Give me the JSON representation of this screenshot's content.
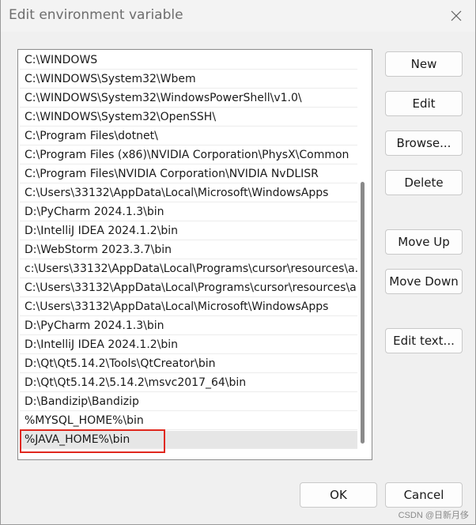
{
  "window": {
    "title": "Edit environment variable"
  },
  "list": {
    "items": [
      "C:\\WINDOWS",
      "C:\\WINDOWS\\System32\\Wbem",
      "C:\\WINDOWS\\System32\\WindowsPowerShell\\v1.0\\",
      "C:\\WINDOWS\\System32\\OpenSSH\\",
      "C:\\Program Files\\dotnet\\",
      "C:\\Program Files (x86)\\NVIDIA Corporation\\PhysX\\Common",
      "C:\\Program Files\\NVIDIA Corporation\\NVIDIA NvDLISR",
      "C:\\Users\\33132\\AppData\\Local\\Microsoft\\WindowsApps",
      "D:\\PyCharm 2024.1.3\\bin",
      "D:\\IntelliJ IDEA 2024.1.2\\bin",
      "D:\\WebStorm 2023.3.7\\bin",
      "c:\\Users\\33132\\AppData\\Local\\Programs\\cursor\\resources\\a...",
      "C:\\Users\\33132\\AppData\\Local\\Programs\\cursor\\resources\\a...",
      "C:\\Users\\33132\\AppData\\Local\\Microsoft\\WindowsApps",
      "D:\\PyCharm 2024.1.3\\bin",
      "D:\\IntelliJ IDEA 2024.1.2\\bin",
      "D:\\Qt\\Qt5.14.2\\Tools\\QtCreator\\bin",
      "D:\\Qt\\Qt5.14.2\\5.14.2\\msvc2017_64\\bin",
      "D:\\Bandizip\\Bandizip",
      "%MYSQL_HOME%\\bin",
      "%JAVA_HOME%\\bin"
    ],
    "selected_index": 20,
    "highlight_color": "#e0281e"
  },
  "buttons": {
    "new": "New",
    "edit": "Edit",
    "browse": "Browse...",
    "delete": "Delete",
    "move_up": "Move Up",
    "move_down": "Move Down",
    "edit_text": "Edit text...",
    "ok": "OK",
    "cancel": "Cancel"
  },
  "watermark": "CSDN @日新月侈",
  "icons": {
    "close": "close-icon"
  }
}
